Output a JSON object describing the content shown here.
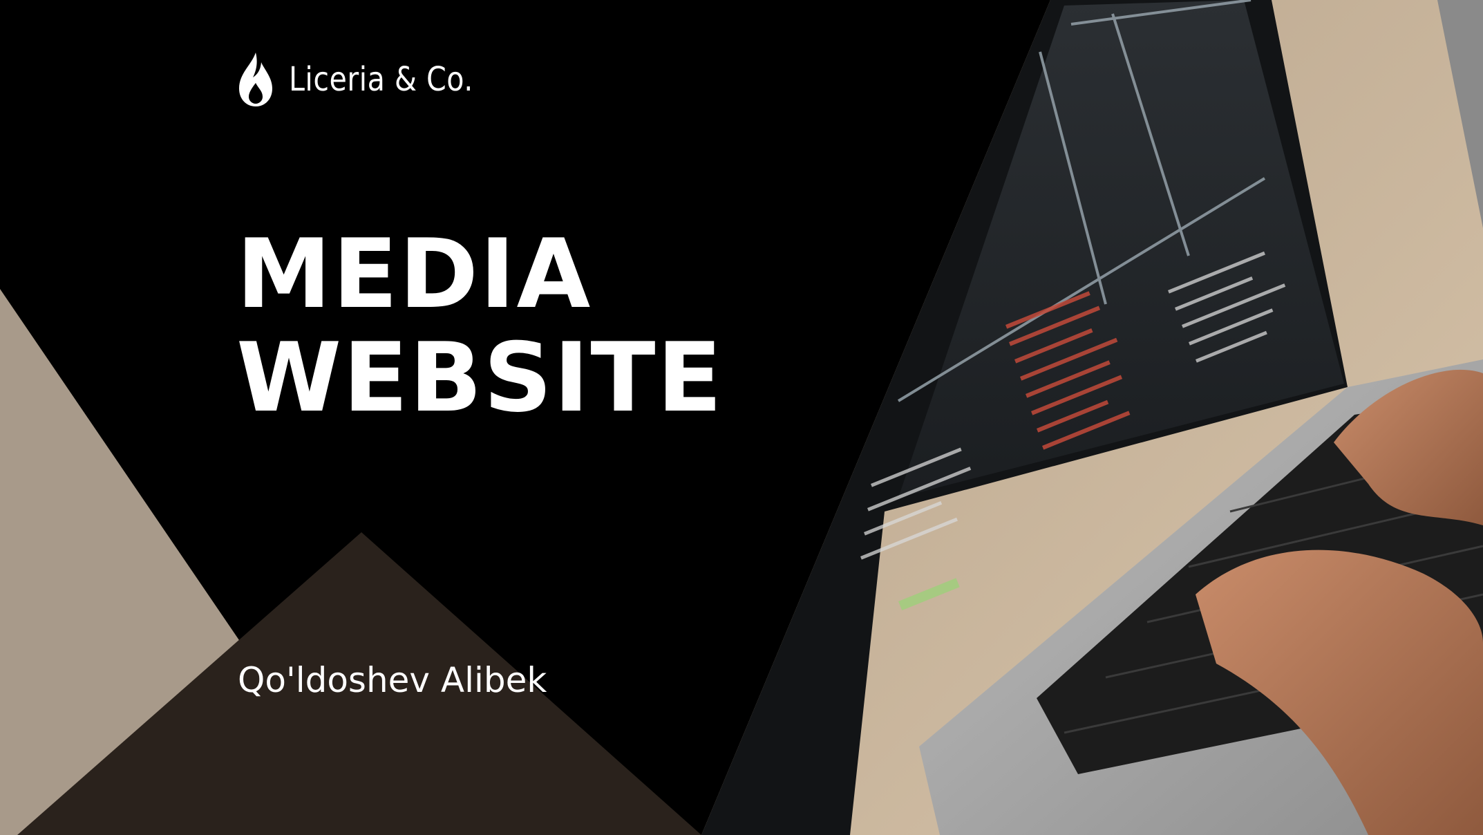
{
  "brand": {
    "name": "Liceria & Co.",
    "icon": "flame-drop-icon"
  },
  "title": {
    "line1": "MEDIA",
    "line2": "WEBSITE"
  },
  "author": "Qo'ldoshev Alibek",
  "colors": {
    "background": "#000000",
    "beige": "#a89a8a",
    "dark_brown": "#2a221c",
    "text": "#ffffff",
    "desk": "#c8b49a"
  },
  "photo": {
    "subject": "laptop-with-code-photo"
  }
}
